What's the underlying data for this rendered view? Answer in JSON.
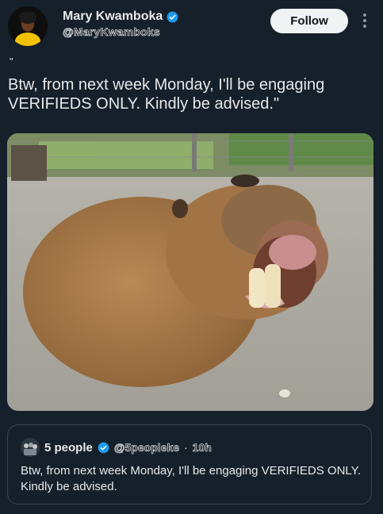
{
  "author": {
    "name": "Mary Kwamboka",
    "handle": "@MaryKwamboks",
    "verified": true
  },
  "follow_label": "Follow",
  "post": {
    "quote_mark": "\"",
    "text": "Btw, from next week Monday, I'll be engaging VERIFIEDS ONLY. Kindly be advised.\""
  },
  "media": {
    "subject": "capybara-photo"
  },
  "quoted_post": {
    "name": "5 people",
    "handle": "@5peopleke",
    "separator": "·",
    "time": "10h",
    "text": "Btw, from next week Monday, I'll be engaging VERIFIEDS ONLY. Kindly be advised."
  },
  "colors": {
    "background": "#15202b",
    "verified": "#1d9bf0",
    "border": "#38444d",
    "follow_bg": "#eff3f4"
  },
  "icons": [
    "verified-badge-icon",
    "more-options-icon"
  ]
}
